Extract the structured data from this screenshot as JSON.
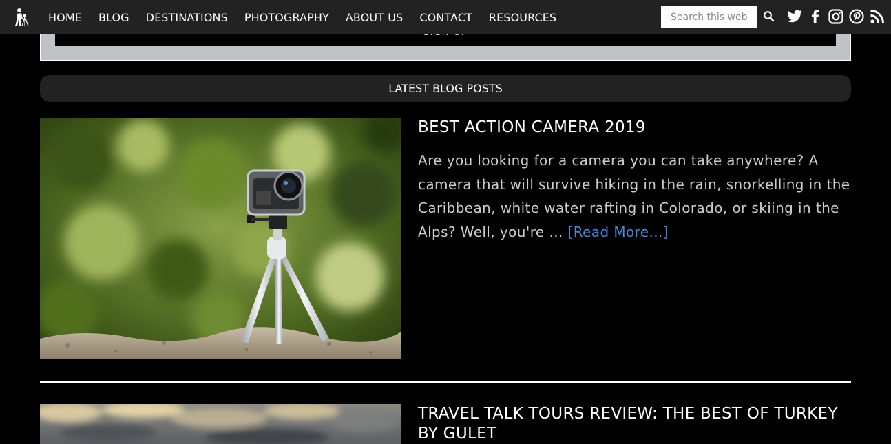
{
  "nav": {
    "items": [
      {
        "label": "HOME"
      },
      {
        "label": "BLOG"
      },
      {
        "label": "DESTINATIONS"
      },
      {
        "label": "PHOTOGRAPHY"
      },
      {
        "label": "ABOUT US"
      },
      {
        "label": "CONTACT"
      },
      {
        "label": "RESOURCES"
      }
    ],
    "search_placeholder": "Search this website",
    "social_icons": [
      "twitter-icon",
      "facebook-icon",
      "instagram-icon",
      "pinterest-icon",
      "rss-icon"
    ]
  },
  "signup": {
    "button_label": "SIGN UP"
  },
  "section": {
    "title": "LATEST BLOG POSTS"
  },
  "posts": [
    {
      "title": "BEST ACTION CAMERA 2019",
      "excerpt": "Are you looking for a camera you can take anywhere? A camera that will survive hiking in the rain, snorkelling in the Caribbean, white water rafting in Colorado, or skiing in the Alps? Well, you're … ",
      "read_more": "[Read More...]"
    },
    {
      "title": "TRAVEL TALK TOURS REVIEW: THE BEST OF TURKEY BY GULET"
    }
  ],
  "colors": {
    "nav_bg": "#222222",
    "page_bg": "#000000",
    "link": "#4a87d4",
    "signup_frame": "#bfc3c7"
  }
}
